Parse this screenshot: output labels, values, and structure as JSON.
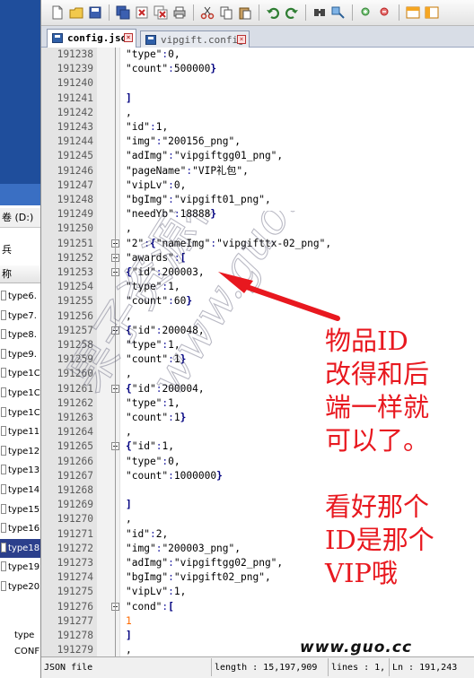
{
  "left_pane": {
    "volume_label": "卷 (D:)",
    "row2": "兵",
    "name_header": "称",
    "files": [
      "type6.",
      "type7.",
      "type8.",
      "type9.",
      "type1C",
      "type1C",
      "type1C",
      "type11",
      "type12",
      "type13",
      "type14",
      "type15",
      "type16",
      "type18",
      "type19",
      "type20"
    ],
    "selected_index": 13,
    "bottom_lines": [
      "type",
      "CONFI"
    ]
  },
  "toolbar": {
    "icons": [
      "new-file-icon",
      "open-file-icon",
      "save-icon",
      "save-all-icon",
      "close-icon",
      "close-all-icon",
      "print-icon",
      "cut-icon",
      "copy-icon",
      "paste-icon",
      "undo-icon",
      "redo-icon",
      "find-icon",
      "replace-icon",
      "zoom-in-icon",
      "zoom-out-icon",
      "sync-vertical-icon",
      "sync-horizontal-icon"
    ]
  },
  "tabs": [
    {
      "label": "config.json",
      "active": true
    },
    {
      "label": "vipgift.config",
      "active": false
    }
  ],
  "lines": [
    {
      "n": "191238",
      "text": "\"type\":0,"
    },
    {
      "n": "191239",
      "text": "\"count\":500000}"
    },
    {
      "n": "191240",
      "text": ""
    },
    {
      "n": "191241",
      "text": "]"
    },
    {
      "n": "191242",
      "text": ","
    },
    {
      "n": "191243",
      "text": "\"id\":1,"
    },
    {
      "n": "191244",
      "text": "\"img\":\"200156_png\","
    },
    {
      "n": "191245",
      "text": "\"adImg\":\"vipgiftgg01_png\","
    },
    {
      "n": "191246",
      "text": "\"pageName\":\"VIP礼包\","
    },
    {
      "n": "191247",
      "text": "\"vipLv\":0,"
    },
    {
      "n": "191248",
      "text": "\"bgImg\":\"vipgift01_png\","
    },
    {
      "n": "191249",
      "text": "\"needYb\":18888}"
    },
    {
      "n": "191250",
      "text": ","
    },
    {
      "n": "191251",
      "text": "\"2\":{\"nameImg\":\"vipgifttx-02_png\","
    },
    {
      "n": "191252",
      "text": "\"awards\":["
    },
    {
      "n": "191253",
      "text": "{\"id\":200003,"
    },
    {
      "n": "191254",
      "text": "\"type\":1,"
    },
    {
      "n": "191255",
      "text": "\"count\":60}"
    },
    {
      "n": "191256",
      "text": ","
    },
    {
      "n": "191257",
      "text": "{\"id\":200048,"
    },
    {
      "n": "191258",
      "text": "\"type\":1,"
    },
    {
      "n": "191259",
      "text": "\"count\":1}"
    },
    {
      "n": "191260",
      "text": ","
    },
    {
      "n": "191261",
      "text": "{\"id\":200004,"
    },
    {
      "n": "191262",
      "text": "\"type\":1,"
    },
    {
      "n": "191263",
      "text": "\"count\":1}"
    },
    {
      "n": "191264",
      "text": ","
    },
    {
      "n": "191265",
      "text": "{\"id\":1,"
    },
    {
      "n": "191266",
      "text": "\"type\":0,"
    },
    {
      "n": "191267",
      "text": "\"count\":1000000}"
    },
    {
      "n": "191268",
      "text": ""
    },
    {
      "n": "191269",
      "text": "]"
    },
    {
      "n": "191270",
      "text": ","
    },
    {
      "n": "191271",
      "text": "\"id\":2,"
    },
    {
      "n": "191272",
      "text": "\"img\":\"200003_png\","
    },
    {
      "n": "191273",
      "text": "\"adImg\":\"vipgiftgg02_png\","
    },
    {
      "n": "191274",
      "text": "\"bgImg\":\"vipgift02_png\","
    },
    {
      "n": "191275",
      "text": "\"vipLv\":1,"
    },
    {
      "n": "191276",
      "text": "\"cond\":["
    },
    {
      "n": "191277",
      "text": "1"
    },
    {
      "n": "191278",
      "text": "]"
    },
    {
      "n": "191279",
      "text": ","
    }
  ],
  "fold_markers": [
    "191251",
    "191252",
    "191253",
    "191257",
    "191261",
    "191265",
    "191276"
  ],
  "status": {
    "file_type": "JSON file",
    "length": "length : 15,197,909",
    "lines": "lines : 1,",
    "ln": "Ln : 191,243"
  },
  "annotation": {
    "note": "物品ID\n改得和后\n端一样就\n可以了。\n\n看好那个\nID是那个\nVIP哦",
    "color": "#e8181f"
  },
  "watermark": {
    "cn": "果子资源社区",
    "url": "www.guo.cc"
  },
  "bottom_logo": "www.guo.cc"
}
